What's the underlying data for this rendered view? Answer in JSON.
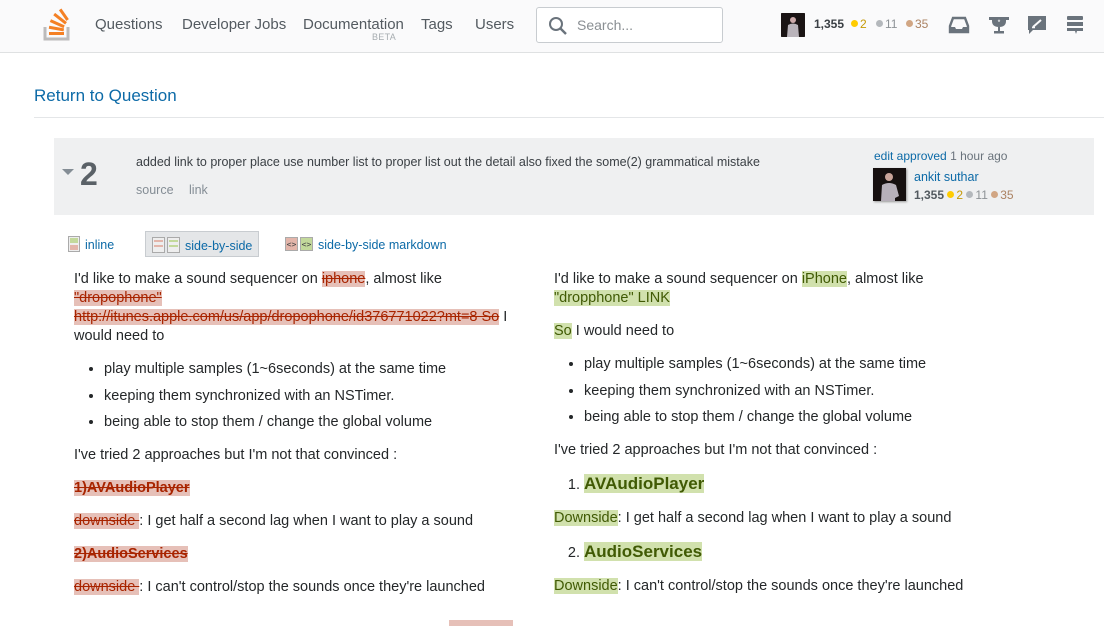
{
  "topbar": {
    "nav": [
      {
        "label": "Questions"
      },
      {
        "label": "Developer Jobs"
      },
      {
        "label": "Documentation",
        "sublabel": "BETA"
      },
      {
        "label": "Tags"
      },
      {
        "label": "Users"
      }
    ],
    "search": {
      "placeholder": "Search...",
      "value": ""
    },
    "user": {
      "reputation": "1,355",
      "gold": "2",
      "silver": "11",
      "bronze": "35"
    },
    "icons": [
      "inbox-icon",
      "achievements-icon",
      "review-icon",
      "help-menu-icon"
    ]
  },
  "page": {
    "return_link": "Return to Question"
  },
  "revision": {
    "number": "2",
    "comment": "added link to proper place use number list to proper list out the detail also fixed the some(2) grammatical mistake",
    "links": [
      "source",
      "link"
    ],
    "approved_label": "edit approved",
    "approved_time": "1 hour ago",
    "editor": {
      "name": "ankit suthar",
      "reputation": "1,355",
      "gold": "2",
      "silver": "11",
      "bronze": "35"
    }
  },
  "view_tabs": [
    {
      "label": "inline",
      "active": false
    },
    {
      "label": "side-by-side",
      "active": true
    },
    {
      "label": "side-by-side markdown",
      "active": false
    }
  ],
  "diff": {
    "left": {
      "p1_a": "I'd like to make a sound sequencer on ",
      "p1_del1": "iphone",
      "p1_b": ", almost like ",
      "p1_del2": "\"dropophone\" http://itunes.apple.com/us/app/dropophone/id376771022?mt=8 So",
      "p1_c": " I would need to",
      "bullets": [
        "play multiple samples (1~6seconds) at the same time",
        "keeping them synchronized with an NSTimer.",
        "being able to stop them / change the global volume"
      ],
      "p_tried": "I've tried 2 approaches but I'm not that convinced :",
      "h1_del": "1)AVAudioPlayer",
      "ds1_del": "downside ",
      "ds1_text": ": I get half a second lag when I want to play a sound",
      "h2_del": "2)AudioServices",
      "ds2_del": "downside ",
      "ds2_text": ": I can't control/stop the sounds once they're launched"
    },
    "right": {
      "p1_a": "I'd like to make a sound sequencer on ",
      "p1_ins1": "iPhone",
      "p1_b": ", almost like ",
      "p1_ins2": "\"dropphone\" LINK",
      "p2_ins": "So",
      "p2_text": " I would need to",
      "bullets": [
        "play multiple samples (1~6seconds) at the same time",
        "keeping them synchronized with an NSTimer.",
        "being able to stop them / change the global volume"
      ],
      "p_tried": "I've tried 2 approaches but I'm not that convinced :",
      "h1_ins": "AVAudioPlayer",
      "ds1_ins": "Downside",
      "ds1_text": ": I get half a second lag when I want to play a sound",
      "h2_ins": "AudioServices",
      "ds2_ins": "Downside",
      "ds2_text": ": I can't control/stop the sounds once they're launched"
    }
  },
  "colors": {
    "link": "#0c6aa7",
    "deleted_bg": "#e6c0b8",
    "deleted_text": "#a82400",
    "inserted_bg": "#d1e1ad",
    "inserted_text": "#405a04",
    "brand_orange": "#f48024"
  }
}
